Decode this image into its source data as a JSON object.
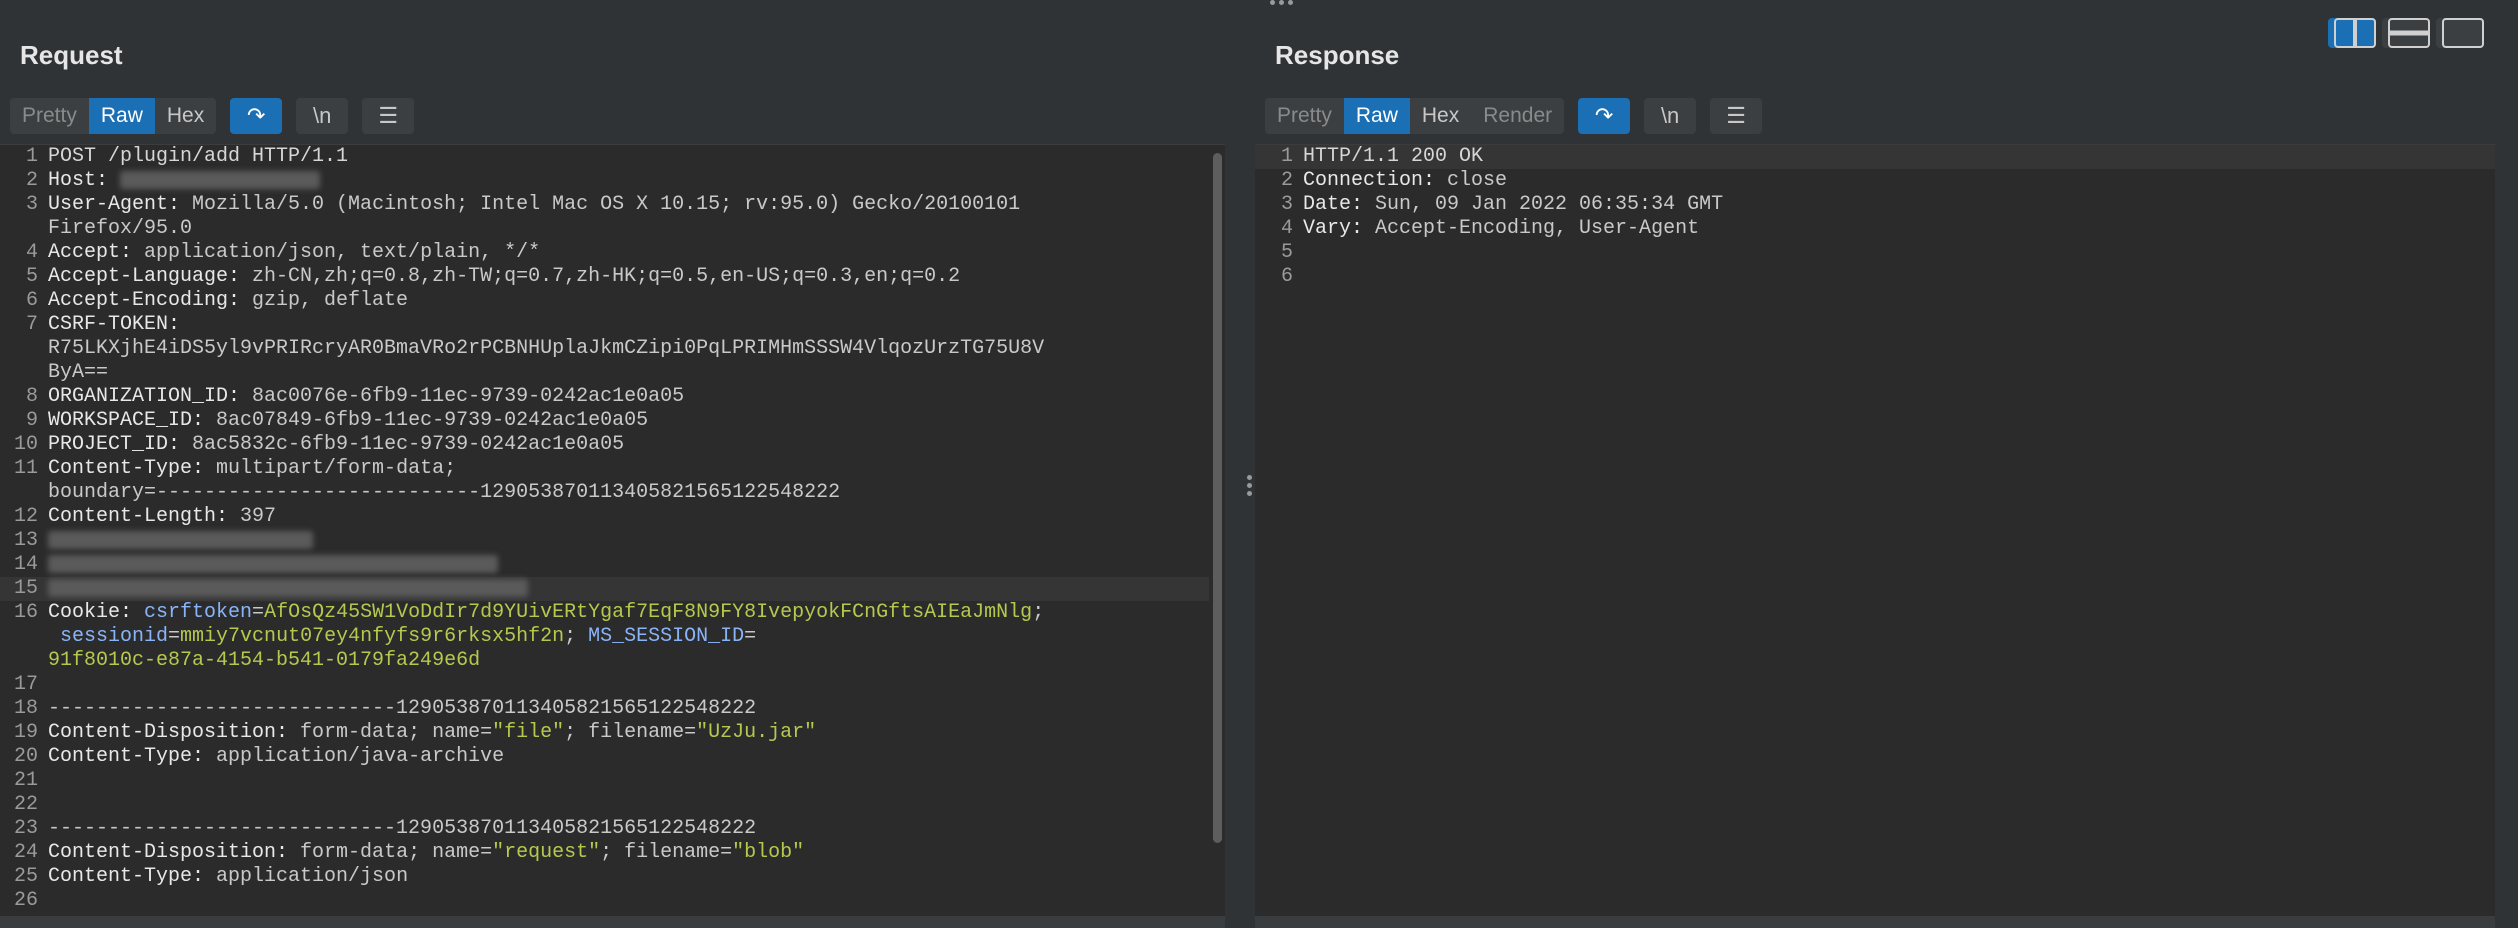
{
  "request": {
    "title": "Request",
    "tabs": [
      {
        "label": "Pretty"
      },
      {
        "label": "Raw"
      },
      {
        "label": "Hex"
      }
    ],
    "newline_label": "\\n",
    "lines": {
      "l1": "POST /plugin/add HTTP/1.1",
      "l2k": "Host:",
      "l3k": "User-Agent:",
      "l3v": " Mozilla/5.0 (Macintosh; Intel Mac OS X 10.15; rv:95.0) Gecko/20100101",
      "l3b": "Firefox/95.0",
      "l4k": "Accept:",
      "l4v": " application/json, text/plain, */*",
      "l5k": "Accept-Language:",
      "l5v": " zh-CN,zh;q=0.8,zh-TW;q=0.7,zh-HK;q=0.5,en-US;q=0.3,en;q=0.2",
      "l6k": "Accept-Encoding:",
      "l6v": " gzip, deflate",
      "l7k": "CSRF-TOKEN:",
      "l7b": "R75LKXjhE4iDS5yl9vPRIRcryAR0BmaVRo2rPCBNHUplaJkmCZipi0PqLPRIMHmSSSW4VlqozUrzTG75U8V",
      "l7c": "ByA==",
      "l8k": "ORGANIZATION_ID:",
      "l8v": " 8ac0076e-6fb9-11ec-9739-0242ac1e0a05",
      "l9k": "WORKSPACE_ID:",
      "l9v": " 8ac07849-6fb9-11ec-9739-0242ac1e0a05",
      "l10k": "PROJECT_ID:",
      "l10v": " 8ac5832c-6fb9-11ec-9739-0242ac1e0a05",
      "l11k": "Content-Type:",
      "l11v": " multipart/form-data;",
      "l11b": "boundary=---------------------------129053870113405821565122548222",
      "l12k": "Content-Length:",
      "l12v": " 397",
      "l16k": "Cookie:",
      "l16a": " csrftoken",
      "l16b": "AfOsQz45SW1VoDdIr7d9YUivERtYgaf7EqF8N9FY8IvepyokFCnGftsAIEaJmNlg",
      "l16c": " sessionid",
      "l16d": "mmiy7vcnut07ey4nfyfs9r6rksx5hf2n",
      "l16e": " MS_SESSION_ID",
      "l16f": "91f8010c-e87a-4154-b541-0179fa249e6d",
      "l18": "-----------------------------129053870113405821565122548222",
      "l19k": "Content-Disposition:",
      "l19a": " form-data; name=",
      "l19b": "\"file\"",
      "l19c": "; filename=",
      "l19d": "\"UzJu.jar\"",
      "l20k": "Content-Type:",
      "l20v": " application/java-archive",
      "l23": "-----------------------------129053870113405821565122548222",
      "l24k": "Content-Disposition:",
      "l24a": " form-data; name=",
      "l24b": "\"request\"",
      "l24c": "; filename=",
      "l24d": "\"blob\"",
      "l25k": "Content-Type:",
      "l25v": " application/json"
    }
  },
  "response": {
    "title": "Response",
    "tabs": [
      {
        "label": "Pretty"
      },
      {
        "label": "Raw"
      },
      {
        "label": "Hex"
      },
      {
        "label": "Render"
      }
    ],
    "newline_label": "\\n",
    "lines": {
      "l1": "HTTP/1.1 200 OK",
      "l2k": "Connection:",
      "l2v": " close",
      "l3k": "Date:",
      "l3v": " Sun, 09 Jan 2022 06:35:34 GMT",
      "l4k": "Vary:",
      "l4v": " Accept-Encoding, User-Agent"
    }
  },
  "colors": {
    "accent": "#1a6fb5",
    "cookie_key": "#8ab4f8",
    "cookie_value": "#b5c94e"
  }
}
